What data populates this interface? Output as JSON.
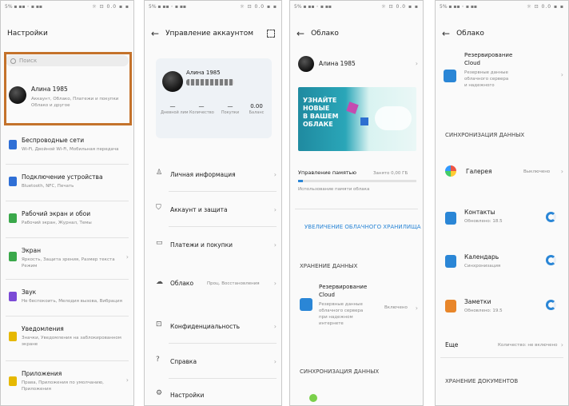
{
  "status_bar": {
    "left": "5% ▪ ▪▪ ◦ ▪ ▪▪",
    "right": "☼ ⊡ 0.0 ▪ ▪"
  },
  "panel1": {
    "title": "Настройки",
    "search_placeholder": "Поиск",
    "account": {
      "name": "Алина 1985",
      "sub1": "Аккаунт, Облако, Платежи и покупки",
      "sub2": "Облако и другое"
    },
    "items": [
      {
        "title": "Беспроводные сети",
        "sub": "Wi-Fi, Двойной Wi-Fi, Мобильная передача",
        "color": "#2f6fd6"
      },
      {
        "title": "Подключение устройства",
        "sub": "Bluetooth, NFC, Печать",
        "color": "#2f6fd6"
      },
      {
        "title": "Рабочий экран и обои",
        "sub": "Рабочий экран, Журнал, Темы",
        "color": "#3aa84a"
      },
      {
        "title": "Экран",
        "sub": "Яркость, Защита зрения, Размер текста",
        "sub2": "Режим",
        "color": "#3aa84a"
      },
      {
        "title": "Звук",
        "sub": "Не беспокоить, Мелодия вызова, Вибрация",
        "color": "#7b4ad6"
      },
      {
        "title": "Уведомления",
        "sub": "Значки, Уведомления на заблокированном",
        "sub2": "экране",
        "color": "#e6b800"
      },
      {
        "title": "Приложения",
        "sub": "Права, Приложения по умолчанию,",
        "sub2": "Приложения",
        "color": "#e6b800"
      }
    ]
  },
  "panel2": {
    "title": "Управление аккаунтом",
    "profile_name": "Алина 1985",
    "stats": [
      {
        "value": "—",
        "label": "Дневной лим"
      },
      {
        "value": "—",
        "label": "Количество"
      },
      {
        "value": "—",
        "label": "Покупки"
      },
      {
        "value": "0.00",
        "label": "Баланс"
      }
    ],
    "menu": [
      {
        "label": "Личная информация",
        "icon": "person-icon"
      },
      {
        "label": "Аккаунт и защита",
        "icon": "shield-icon"
      },
      {
        "label": "Платежи и покупки",
        "icon": "card-icon"
      },
      {
        "label": "Облако",
        "value": "Проц. Восстановления",
        "icon": "cloud-icon"
      },
      {
        "label": "Конфиденциальность",
        "icon": "lock-icon"
      },
      {
        "label": "Справка",
        "icon": "help-icon"
      },
      {
        "label": "Настройки",
        "icon": "gear-icon"
      }
    ]
  },
  "panel3": {
    "title": "Облако",
    "user": "Алина 1985",
    "banner_text": [
      "УЗНАЙТЕ",
      "НОВЫЕ",
      "В ВАШЕМ",
      "ОБЛАКЕ"
    ],
    "storage_label": "Управление памятью",
    "storage_value": "Занято 0,00 ГБ",
    "storage_sub": "Использование памяти облака",
    "upgrade_link": "УВЕЛИЧЕНИЕ ОБЛАЧНОГО ХРАНИЛИЩА",
    "backup_section": "ХРАНЕНИЕ ДАННЫХ",
    "backup_title": "Резервирование",
    "backup_title2": "Cloud",
    "backup_desc": [
      "Резервные данные",
      "облачного сервера",
      "при надежном",
      "интернете"
    ],
    "backup_status": "Включено",
    "sync_section": "СИНХРОНИЗАЦИЯ ДАННЫХ"
  },
  "panel4": {
    "title": "Облако",
    "backup_title": "Резервирование",
    "backup_title2": "Cloud",
    "backup_desc": [
      "Резервные данные",
      "облачного сервера",
      "и надежного"
    ],
    "sync_header": "СИНХРОНИЗАЦИЯ ДАННЫХ",
    "gallery_label": "Галерея",
    "gallery_status": "Выключено",
    "items": [
      {
        "title": "Контакты",
        "sub": "Обновлено: 18.5",
        "color": "#2a86d6"
      },
      {
        "title": "Календарь",
        "sub": "Синхронизация",
        "color": "#2a86d6"
      },
      {
        "title": "Заметки",
        "sub": "Обновлено: 19.5",
        "color": "#e8862a"
      }
    ],
    "more_label": "Еще",
    "more_value": "Количество: не включено",
    "footer_header": "ХРАНЕНИЕ ДОКУМЕНТОВ"
  },
  "colors": {
    "highlight": "#c4722b",
    "accent": "#2a86d6"
  }
}
